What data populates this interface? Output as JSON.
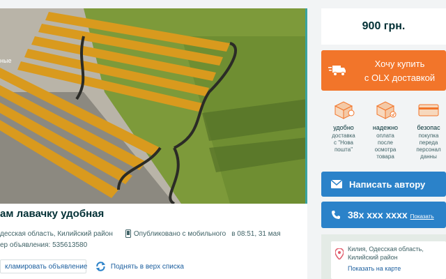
{
  "listing": {
    "corner_label": "ные",
    "title": "ам лавачку удобная",
    "location": "десская область, Килийский район",
    "published": "Опубликовано с мобильного",
    "published_time": "в 08:51, 31 мая",
    "id_text": "ер объявления: 535613580",
    "complain_label": "кламировать объявление",
    "raise_label": "Поднять в верх списка"
  },
  "sidebar": {
    "price": "900 грн.",
    "buy_line1": "Хочу купить",
    "buy_line2": "с OLX доставкой",
    "features": [
      {
        "title": "удобно",
        "desc": [
          "доставка",
          "с \"Нова",
          "пошта\""
        ]
      },
      {
        "title": "надежно",
        "desc": [
          "оплата",
          "после",
          "осмотра",
          "товара"
        ]
      },
      {
        "title": "безопас",
        "desc": [
          "покупка",
          "переда",
          "персонал",
          "данны"
        ]
      }
    ],
    "write_label": "Написать автору",
    "phone": "38x xxx xxxx",
    "phone_show": "Показать",
    "map_loc1": "Килия, Одесская область,",
    "map_loc2": "Килийский район",
    "map_show": "Показать на карте"
  },
  "colors": {
    "accent_orange": "#f2752a",
    "accent_blue": "#2b82c9",
    "text_dark": "#002f34"
  }
}
